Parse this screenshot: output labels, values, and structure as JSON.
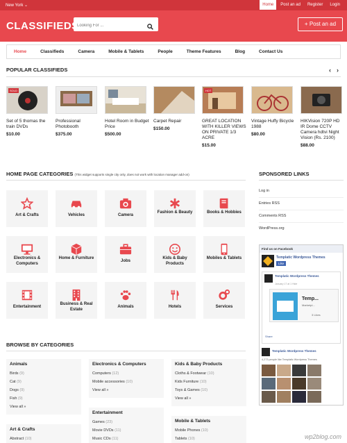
{
  "topbar": {
    "city": "New York",
    "links": [
      "Home",
      "Post an ad",
      "Register",
      "Login"
    ]
  },
  "header": {
    "logo": "CLASSIFIEDS",
    "search_placeholder": "Looking For ...",
    "post_ad": "+ Post an ad"
  },
  "nav": [
    "Home",
    "Classifieds",
    "Camera",
    "Mobile & Tablets",
    "People",
    "Theme Features",
    "Blog",
    "Contact Us"
  ],
  "popular": {
    "title": "POPULAR CLASSIFIEDS",
    "items": [
      {
        "title": "Set of 5 thomas the train DVDs",
        "price": "$10.00",
        "badge": "SOLD"
      },
      {
        "title": "Professional Photobooth",
        "price": "$375.00",
        "badge": ""
      },
      {
        "title": "Hotel Room in Budget Price",
        "price": "$500.00",
        "badge": ""
      },
      {
        "title": "Carpet Repair",
        "price": "$150.00",
        "badge": ""
      },
      {
        "title": "GREAT LOCATION WITH KILLER VIEWS ON PRIVATE 1/3 ACRE",
        "price": "$15.00",
        "badge": "HOT"
      },
      {
        "title": "Vintage Huffy Bicycle 1988",
        "price": "$80.00",
        "badge": ""
      },
      {
        "title": "HIKVision 720P HD IR Dome CCTV Camera hdtvi Night Vision (Rs. 2100)",
        "price": "$88.00",
        "badge": ""
      }
    ]
  },
  "categories": {
    "title": "HOME PAGE CATEGORIES",
    "note": "(This widget supports single city only, does not work with location manager add-on)",
    "items": [
      "Art & Crafts",
      "Vehicles",
      "Camera",
      "Fashion & Beauty",
      "Books & Hobbies",
      "Electronics & Computers",
      "Home & Furniture",
      "Jobs",
      "Kids & Baby Products",
      "Mobiles & Tablets",
      "Entertainment",
      "Business & Real Estate",
      "Animals",
      "Hotels",
      "Services"
    ]
  },
  "sponsored": {
    "title": "SPONSORED LINKS",
    "links": [
      "Log in",
      "Entries RSS",
      "Comments RSS",
      "WordPress.org"
    ]
  },
  "facebook": {
    "header": "Find us on Facebook",
    "page_name": "Templatic Wordpress Themes",
    "like": "Like",
    "post_name": "Templatic Wordpress Themes",
    "post_date": "January 17 at 1 Hide",
    "post_card_title": "Temp...",
    "post_card_sub": "Marketpl...",
    "likes": "3 Likes",
    "share": "Share",
    "fans": "4,273 people like Templatic Wordpress Themes"
  },
  "browse": {
    "title": "BROWSE BY CATEGORIES",
    "columns": [
      {
        "heading": "Animals",
        "items": [
          {
            "name": "Birds",
            "count": "(9)"
          },
          {
            "name": "Cat",
            "count": "(9)"
          },
          {
            "name": "Dogs",
            "count": "(9)"
          },
          {
            "name": "Fish",
            "count": "(9)"
          }
        ],
        "view_all": "View all »"
      },
      {
        "heading": "Electronics & Computers",
        "items": [
          {
            "name": "Computers",
            "count": "(12)"
          },
          {
            "name": "Mobile accessories",
            "count": "(10)"
          }
        ],
        "view_all": "View all »"
      },
      {
        "heading": "Kids & Baby Products",
        "items": [
          {
            "name": "Cloths & Footwear",
            "count": "(10)"
          },
          {
            "name": "Kids Furniture",
            "count": "(10)"
          },
          {
            "name": "Toys & Games",
            "count": "(10)"
          }
        ],
        "view_all": "View all »"
      },
      {
        "heading": "Art & Crafts",
        "items": [
          {
            "name": "Abstract",
            "count": "(10)"
          }
        ],
        "view_all": ""
      },
      {
        "heading": "Entertainment",
        "items": [
          {
            "name": "Games",
            "count": "(23)"
          },
          {
            "name": "Movie DVDs",
            "count": "(11)"
          },
          {
            "name": "Music CDs",
            "count": "(11)"
          }
        ],
        "view_all": ""
      },
      {
        "heading": "Mobile & Tablets",
        "items": [
          {
            "name": "Mobile Phones",
            "count": "(10)"
          },
          {
            "name": "Tablets",
            "count": "(10)"
          }
        ],
        "view_all": ""
      }
    ]
  },
  "watermark": "wp2blog.com",
  "colors": {
    "primary": "#e8484e",
    "dark": "#d0353b"
  }
}
